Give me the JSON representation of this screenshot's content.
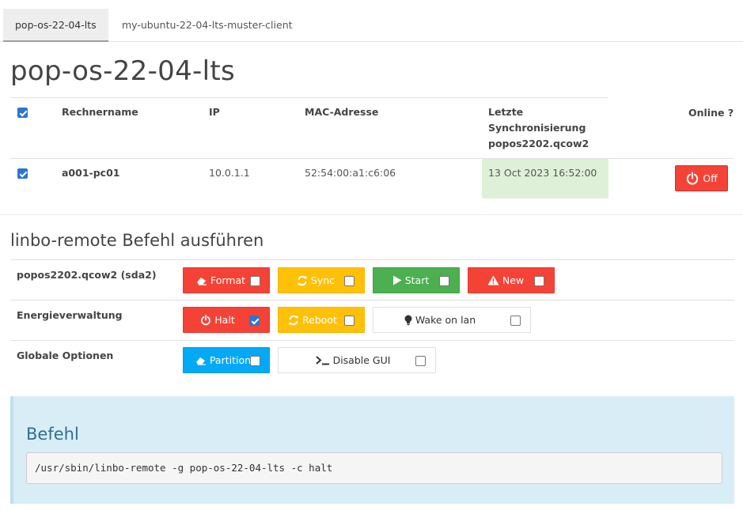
{
  "tabs": [
    {
      "label": "pop-os-22-04-lts",
      "active": true
    },
    {
      "label": "my-ubuntu-22-04-lts-muster-client",
      "active": false
    }
  ],
  "page_title": "pop-os-22-04-lts",
  "hosts_table": {
    "headers": {
      "name": "Rechnername",
      "ip": "IP",
      "mac": "MAC-Adresse",
      "sync_line1": "Letzte",
      "sync_line2": "Synchronisierung",
      "sync_line3": "popos2202.qcow2",
      "online": "Online ?"
    },
    "select_all_checked": true,
    "rows": [
      {
        "checked": true,
        "name": "a001-pc01",
        "ip": "10.0.1.1",
        "mac": "52:54:00:a1:c6:06",
        "last_sync": "13 Oct 2023 16:52:00",
        "online_label": "Off"
      }
    ]
  },
  "section_title": "linbo-remote Befehl ausführen",
  "command_rows": [
    {
      "label": "popos2202.qcow2 (sda2)",
      "buttons": [
        {
          "label": "Format",
          "icon": "eraser-icon",
          "color": "#f44336",
          "checked": false
        },
        {
          "label": "Sync",
          "icon": "refresh-icon",
          "color": "#ffc107",
          "checked": false
        },
        {
          "label": "Start",
          "icon": "play-icon",
          "color": "#4caf50",
          "checked": false
        },
        {
          "label": "New",
          "icon": "warning-icon",
          "color": "#f44336",
          "checked": false
        }
      ]
    },
    {
      "label": "Energieverwaltung",
      "buttons": [
        {
          "label": "Halt",
          "icon": "power-icon",
          "color": "#f44336",
          "checked": true
        },
        {
          "label": "Reboot",
          "icon": "refresh-icon",
          "color": "#ffc107",
          "checked": false
        },
        {
          "label": "Wake on lan",
          "icon": "lightbulb-icon",
          "color": "#ffffff",
          "checked": false
        }
      ]
    },
    {
      "label": "Globale Optionen",
      "buttons": [
        {
          "label": "Partition",
          "icon": "eraser-icon",
          "color": "#03a9f4",
          "checked": false
        },
        {
          "label": "Disable GUI",
          "icon": "terminal-icon",
          "color": "#ffffff",
          "checked": false
        }
      ]
    }
  ],
  "befehl": {
    "title": "Befehl",
    "command": "/usr/sbin/linbo-remote -g pop-os-22-04-lts -c halt"
  }
}
